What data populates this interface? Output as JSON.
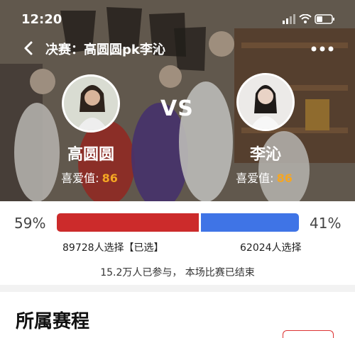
{
  "status_bar": {
    "time": "12:20"
  },
  "nav": {
    "title": "决赛：高圆圆pk李沁"
  },
  "vs_label": "VS",
  "candidates": {
    "left": {
      "name": "高圆圆",
      "like_label": "喜爱值:",
      "like_value": "86"
    },
    "right": {
      "name": "李沁",
      "like_label": "喜爱值:",
      "like_value": "86"
    }
  },
  "vote": {
    "left_percent": "59%",
    "right_percent": "41%",
    "left_share": 0.59,
    "right_share": 0.41,
    "left_count_text": "89728人选择【已选】",
    "right_count_text": "62024人选择",
    "left_color": "#cc2b2b",
    "right_color": "#3f74e6"
  },
  "summary": "15.2万人已参与，  本场比赛已结束",
  "section": {
    "title": "所属赛程"
  }
}
